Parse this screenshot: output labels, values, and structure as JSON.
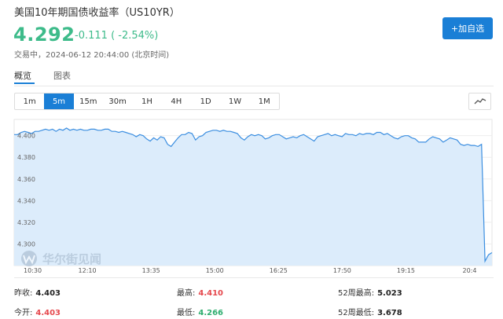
{
  "header": {
    "title": "美国10年期国债收益率（US10YR）",
    "price": "4.292",
    "change": "-0.111",
    "change_pct": "( -2.54%)",
    "status": "交易中，2024-06-12 20:44:00 (北京时间)",
    "watch_button": "+加自选"
  },
  "tabs": [
    {
      "label": "概览",
      "active": true
    },
    {
      "label": "图表",
      "active": false
    }
  ],
  "periods": [
    {
      "label": "1m",
      "active": false
    },
    {
      "label": "5m",
      "active": true
    },
    {
      "label": "15m",
      "active": false
    },
    {
      "label": "30m",
      "active": false
    },
    {
      "label": "1H",
      "active": false
    },
    {
      "label": "4H",
      "active": false
    },
    {
      "label": "1D",
      "active": false
    },
    {
      "label": "1W",
      "active": false
    },
    {
      "label": "1M",
      "active": false
    }
  ],
  "chart_type_icon": "line-chart-icon",
  "watermark": {
    "text": "华尔街见闻",
    "logo": "wallstreetcn-logo"
  },
  "chart_data": {
    "type": "area",
    "ylim": [
      4.28,
      4.415
    ],
    "y_ticks": [
      "4.400",
      "4.380",
      "4.360",
      "4.340",
      "4.320",
      "4.300"
    ],
    "x_ticks": [
      "10:30",
      "12:10",
      "13:35",
      "15:00",
      "16:25",
      "17:50",
      "19:15",
      "20:4"
    ],
    "values": [
      4.401,
      4.401,
      4.403,
      4.404,
      4.403,
      4.402,
      4.404,
      4.404,
      4.405,
      4.406,
      4.405,
      4.406,
      4.404,
      4.406,
      4.405,
      4.407,
      4.405,
      4.406,
      4.405,
      4.406,
      4.405,
      4.405,
      4.406,
      4.406,
      4.405,
      4.405,
      4.406,
      4.406,
      4.404,
      4.404,
      4.403,
      4.404,
      4.403,
      4.402,
      4.401,
      4.399,
      4.401,
      4.4,
      4.397,
      4.395,
      4.398,
      4.396,
      4.399,
      4.398,
      4.392,
      4.39,
      4.394,
      4.398,
      4.401,
      4.401,
      4.403,
      4.402,
      4.396,
      4.399,
      4.4,
      4.403,
      4.404,
      4.405,
      4.405,
      4.404,
      4.405,
      4.404,
      4.404,
      4.403,
      4.402,
      4.398,
      4.396,
      4.399,
      4.401,
      4.4,
      4.401,
      4.4,
      4.397,
      4.398,
      4.4,
      4.401,
      4.401,
      4.399,
      4.397,
      4.398,
      4.399,
      4.398,
      4.4,
      4.401,
      4.399,
      4.397,
      4.395,
      4.399,
      4.4,
      4.401,
      4.402,
      4.4,
      4.401,
      4.4,
      4.399,
      4.402,
      4.401,
      4.401,
      4.4,
      4.402,
      4.401,
      4.402,
      4.402,
      4.401,
      4.403,
      4.403,
      4.401,
      4.402,
      4.4,
      4.398,
      4.397,
      4.399,
      4.4,
      4.4,
      4.398,
      4.397,
      4.394,
      4.394,
      4.394,
      4.397,
      4.399,
      4.398,
      4.397,
      4.394,
      4.396,
      4.398,
      4.397,
      4.396,
      4.392,
      4.391,
      4.392,
      4.391,
      4.391,
      4.39,
      4.392,
      4.284,
      4.29,
      4.292
    ]
  },
  "stats": [
    {
      "label": "昨收:",
      "value": "4.403",
      "color": "#222222"
    },
    {
      "label": "最高:",
      "value": "4.410",
      "color": "#e5484d"
    },
    {
      "label": "52周最高:",
      "value": "5.023",
      "color": "#222222"
    },
    {
      "label": "今开:",
      "value": "4.403",
      "color": "#e5484d"
    },
    {
      "label": "最低:",
      "value": "4.266",
      "color": "#2fae6f"
    },
    {
      "label": "52周最低:",
      "value": "3.678",
      "color": "#222222"
    }
  ],
  "colors": {
    "accent": "#1a7fd6",
    "up": "#e5484d",
    "down": "#3dbb8a",
    "line": "#3b8ee0",
    "fill": "#dcecfb"
  }
}
